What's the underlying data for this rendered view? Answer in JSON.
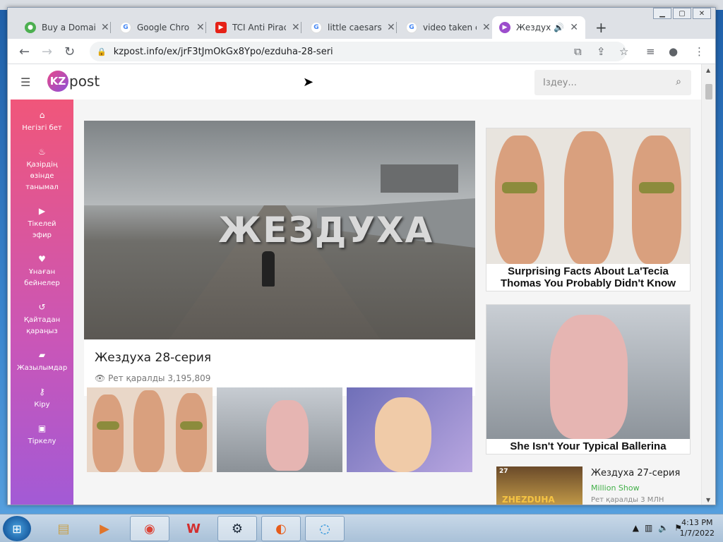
{
  "browser": {
    "tabs": [
      {
        "label": "Buy a Domai",
        "active": false,
        "favicon_color": "#4caf50"
      },
      {
        "label": "Google Chro",
        "active": false,
        "favicon_color": "#4285f4"
      },
      {
        "label": "TCI Anti Pirac",
        "active": false,
        "favicon_color": "#e62117"
      },
      {
        "label": "little caesars",
        "active": false,
        "favicon_color": "#4285f4"
      },
      {
        "label": "video taken c",
        "active": false,
        "favicon_color": "#4285f4"
      },
      {
        "label": "Жездуха",
        "active": true,
        "favicon_color": "#9c4dcc"
      }
    ],
    "url": "kzpost.info/ex/jrF3tJmOkGx8Ypo/ezduha-28-seri",
    "new_tab": "+"
  },
  "site": {
    "logo_kz": "KZ",
    "logo_post": "post",
    "search_placeholder": "Іздеу...",
    "sidebar": [
      {
        "icon": "home-icon",
        "label": "Негізгі бет"
      },
      {
        "icon": "fire-icon",
        "label": "Қазірдің өзінде танымал"
      },
      {
        "icon": "play-icon",
        "label": "Тікелей эфир"
      },
      {
        "icon": "heart-icon",
        "label": "Ұнаған бейнелер"
      },
      {
        "icon": "history-icon",
        "label": "Қайтадан қараңыз"
      },
      {
        "icon": "folder-icon",
        "label": "Жазылымдар"
      },
      {
        "icon": "key-icon",
        "label": "Кіру"
      },
      {
        "icon": "lock-icon",
        "label": "Тіркелу"
      }
    ],
    "main_video": {
      "art_text": "ЖЕЗДУХА",
      "title": "Жездуха 28-серия",
      "views": "Рет қаралды 3,195,809"
    },
    "ads": [
      {
        "caption": "Surprising Facts About La'Tecia Thomas You Probably Didn't Know"
      },
      {
        "caption": "She Isn't Your Typical Ballerina"
      }
    ],
    "related": {
      "title": "Жездуха 27-серия",
      "channel": "Million Show",
      "views": "Рет қаралды 3 МЛН",
      "thumb_text": "ZHEZDUHA",
      "thumb_badge": "27"
    }
  },
  "taskbar": {
    "time": "4:13 PM",
    "date": "1/7/2022"
  }
}
